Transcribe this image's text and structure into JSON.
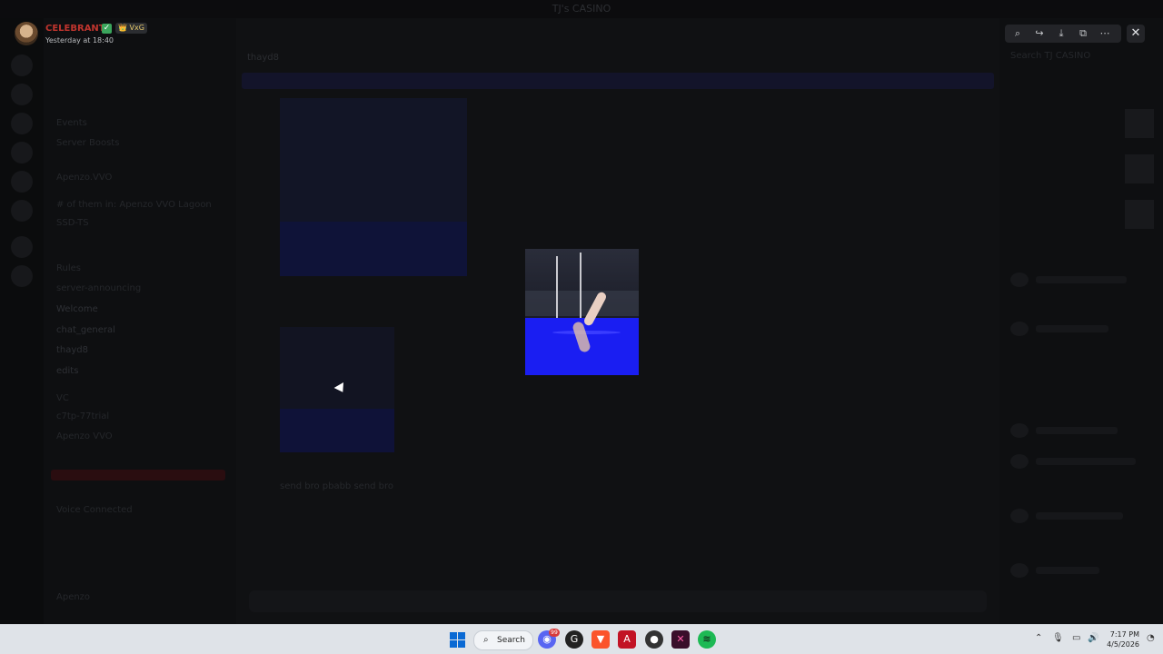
{
  "window": {
    "title": "TJ's CASINO"
  },
  "background": {
    "channel_name": "thayd8",
    "channels": [
      "Events",
      "Server Boosts",
      "Apenzo.VVO",
      "# of them in: Apenzo VVO Lagoon",
      "SSD-TS",
      "Rules",
      "server-announcing",
      "Welcome",
      "chat_general",
      "thayd8",
      "edits",
      "VC",
      "c7tp-77trial",
      "Apenzo VVO"
    ],
    "voice_status": "Voice Connected",
    "user_name": "Apenzo",
    "chat_text": "send bro pbabb send bro",
    "members_header": "Search TJ CASINO"
  },
  "viewer": {
    "author_name": "CELEBRANT",
    "author_tag": "VxG",
    "timestamp": "Yesterday at 18:40",
    "toolbar": {
      "zoom_label": "⌕",
      "forward_label": "↪",
      "download_label": "⤓",
      "open_label": "⧉",
      "more_label": "⋯"
    },
    "close_label": "✕"
  },
  "taskbar": {
    "search_label": "Search",
    "discord_badge": "99",
    "time": "7:17 PM",
    "date": "4/5/2026"
  },
  "colors": {
    "pool": "#1a1ef2",
    "accent_red": "#c0352e",
    "verified": "#3ba55c"
  }
}
